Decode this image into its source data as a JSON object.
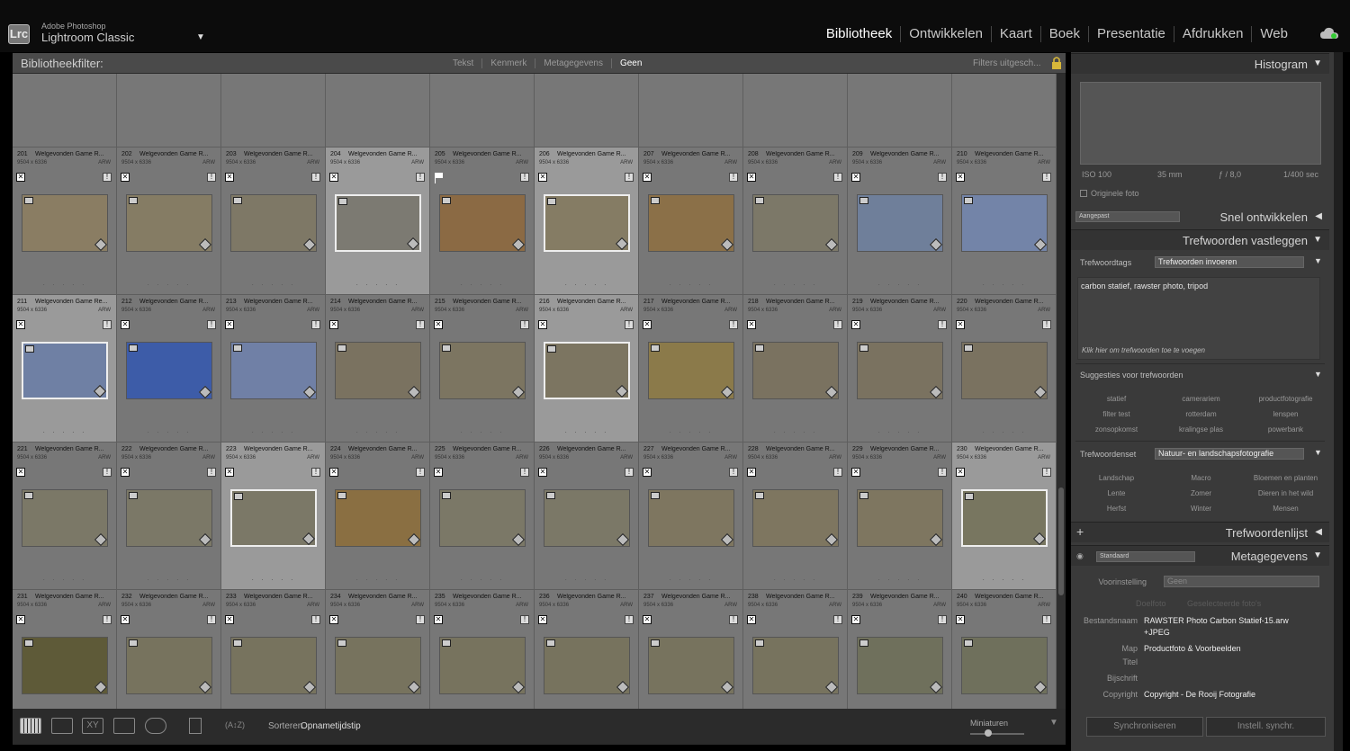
{
  "app": {
    "vendor": "Adobe Photoshop",
    "name": "Lightroom Classic",
    "logo": "Lrc"
  },
  "modules": [
    "Bibliotheek",
    "Ontwikkelen",
    "Kaart",
    "Boek",
    "Presentatie",
    "Afdrukken",
    "Web"
  ],
  "filterbar": {
    "title": "Bibliotheekfilter:",
    "tabs": [
      "Tekst",
      "Kenmerk",
      "Metagegevens",
      "Geen"
    ],
    "preset": "Filters uitgesch..."
  },
  "grid": {
    "file_prefix": "Welgevonden Game R...",
    "dims": "9504 x 6336",
    "ext": "ARW",
    "rows_labels": [
      [
        "201",
        "202",
        "203",
        "204",
        "205",
        "206",
        "207",
        "208",
        "209",
        "210"
      ],
      [
        "211",
        "212",
        "213",
        "214",
        "215",
        "216",
        "217",
        "218",
        "219",
        "220"
      ],
      [
        "221",
        "222",
        "223",
        "224",
        "225",
        "226",
        "227",
        "228",
        "229",
        "230"
      ],
      [
        "231",
        "232",
        "233",
        "234",
        "235",
        "236",
        "237",
        "238",
        "239",
        "240"
      ]
    ],
    "special_name": {
      "211": "Welgevonden Game Re..."
    }
  },
  "toolbar": {
    "sort_label": "Sorteren",
    "sort_value": "Opnametijdstip",
    "thumb_label": "Miniaturen"
  },
  "histogram": {
    "title": "Histogram",
    "iso": "ISO 100",
    "focal": "35 mm",
    "aperture": "ƒ / 8,0",
    "shutter": "1/400 sec",
    "original": "Originele foto"
  },
  "quick_develop": {
    "preset": "Aangepast",
    "title": "Snel ontwikkelen"
  },
  "keywording": {
    "title": "Trefwoorden vastleggen",
    "tags_label": "Trefwoordtags",
    "tags_mode": "Trefwoorden invoeren",
    "keywords": "carbon statief, rawster photo, tripod",
    "hint": "Klik hier om trefwoorden toe te voegen",
    "suggestions_label": "Suggesties voor trefwoorden",
    "suggestions": [
      "statief",
      "camerariem",
      "productfotografie",
      "filter test",
      "rotterdam",
      "lenspen",
      "zonsopkomst",
      "kralingse plas",
      "powerbank"
    ],
    "set_label": "Trefwoordenset",
    "set_value": "Natuur- en landschapsfotografie",
    "set_items": [
      "Landschap",
      "Macro",
      "Bloemen en planten",
      "Lente",
      "Zomer",
      "Dieren in het wild",
      "Herfst",
      "Winter",
      "Mensen"
    ]
  },
  "keyword_list": {
    "add": "+",
    "title": "Trefwoordenlijst"
  },
  "metadata": {
    "view": "Standaard",
    "title": "Metagegevens",
    "preset_label": "Voorinstelling",
    "preset_value": "Geen",
    "target_photo": "Doelfoto",
    "selected_photos": "Geselecteerde foto's",
    "filename_label": "Bestandsnaam",
    "filename_value": "RAWSTER Photo Carbon Statief-15.arw",
    "filename_value2": "+JPEG",
    "folder_label": "Map",
    "folder_value": "Productfoto & Voorbeelden",
    "title_label": "Titel",
    "caption_label": "Bijschrift",
    "copyright_label": "Copyright",
    "copyright_value": "Copyright - De Rooij Fotografie"
  },
  "sync": {
    "sync_button": "Synchroniseren",
    "sync_settings": "Instell. synchr."
  }
}
